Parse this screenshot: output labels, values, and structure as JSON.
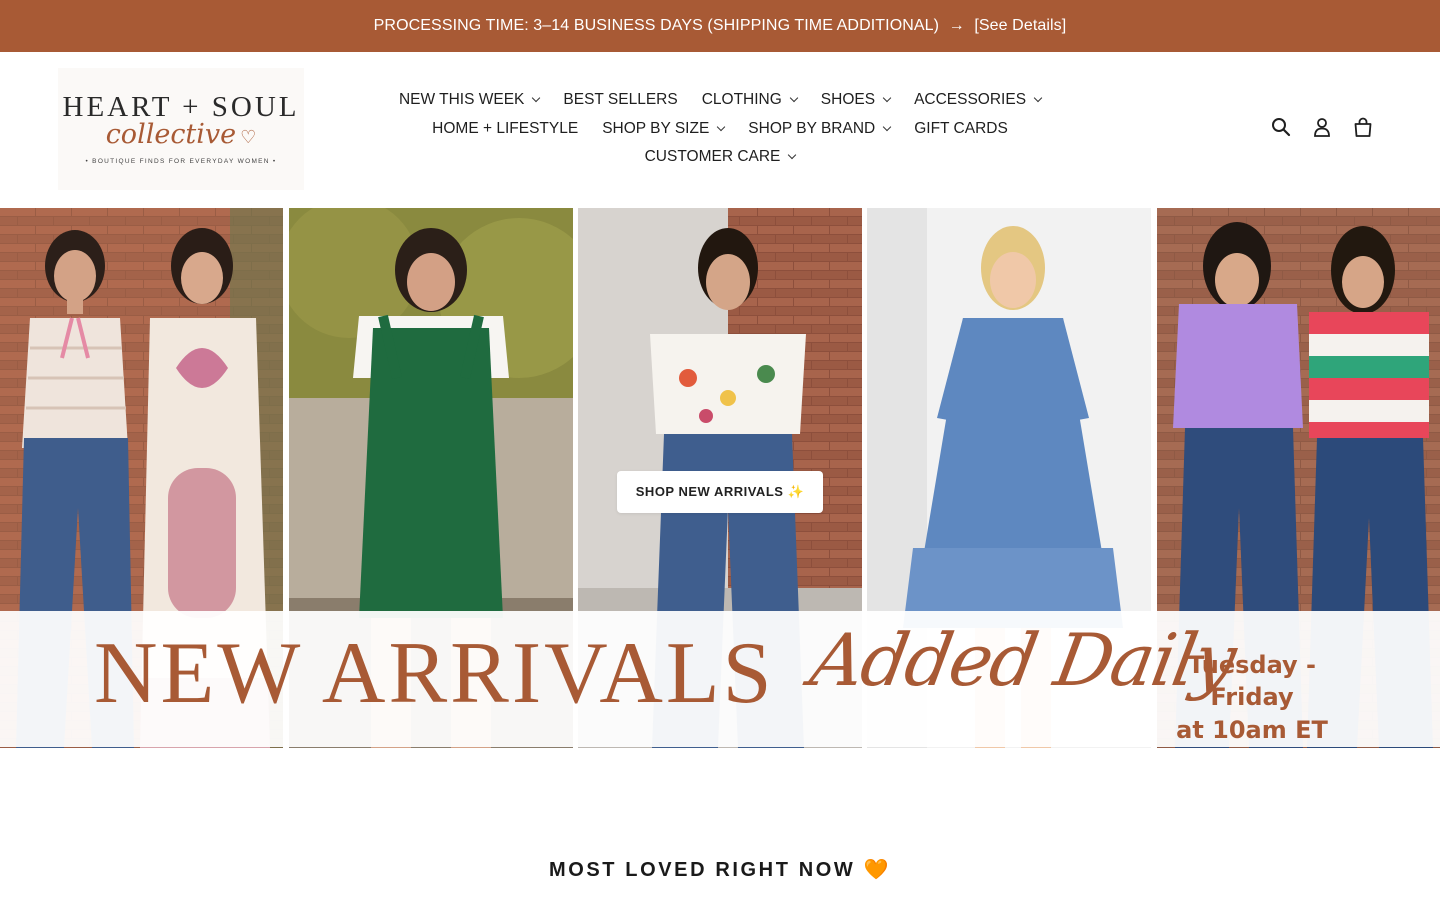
{
  "announcement": {
    "text": "PROCESSING TIME: 3–14 BUSINESS DAYS (SHIPPING TIME ADDITIONAL)",
    "arrow": "→",
    "link": "[See Details]"
  },
  "logo": {
    "line1": "HEART + SOUL",
    "line2": "collective",
    "tagline": "• BOUTIQUE FINDS FOR EVERYDAY WOMEN •"
  },
  "nav": {
    "rows": [
      [
        {
          "label": "NEW THIS WEEK",
          "dropdown": true
        },
        {
          "label": "BEST SELLERS",
          "dropdown": false
        },
        {
          "label": "CLOTHING",
          "dropdown": true
        },
        {
          "label": "SHOES",
          "dropdown": true
        },
        {
          "label": "ACCESSORIES",
          "dropdown": true
        }
      ],
      [
        {
          "label": "HOME + LIFESTYLE",
          "dropdown": false
        },
        {
          "label": "SHOP BY SIZE",
          "dropdown": true
        },
        {
          "label": "SHOP BY BRAND",
          "dropdown": true
        },
        {
          "label": "GIFT CARDS",
          "dropdown": false
        }
      ],
      [
        {
          "label": "CUSTOMER CARE",
          "dropdown": true
        }
      ]
    ]
  },
  "header_icons": [
    "search-icon",
    "account-icon",
    "cart-icon"
  ],
  "hero": {
    "cta_label": "SHOP NEW ARRIVALS ✨",
    "banner_left": "NEW ARRIVALS",
    "banner_script": "Added Daily",
    "banner_right_line1": "Tuesday - Friday",
    "banner_right_line2": "at 10am ET"
  },
  "section": {
    "title": "MOST LOVED RIGHT NOW",
    "emoji": "🧡"
  },
  "colors": {
    "brand": "#a85a35",
    "text": "#1f1f1f",
    "background": "#ffffff"
  }
}
